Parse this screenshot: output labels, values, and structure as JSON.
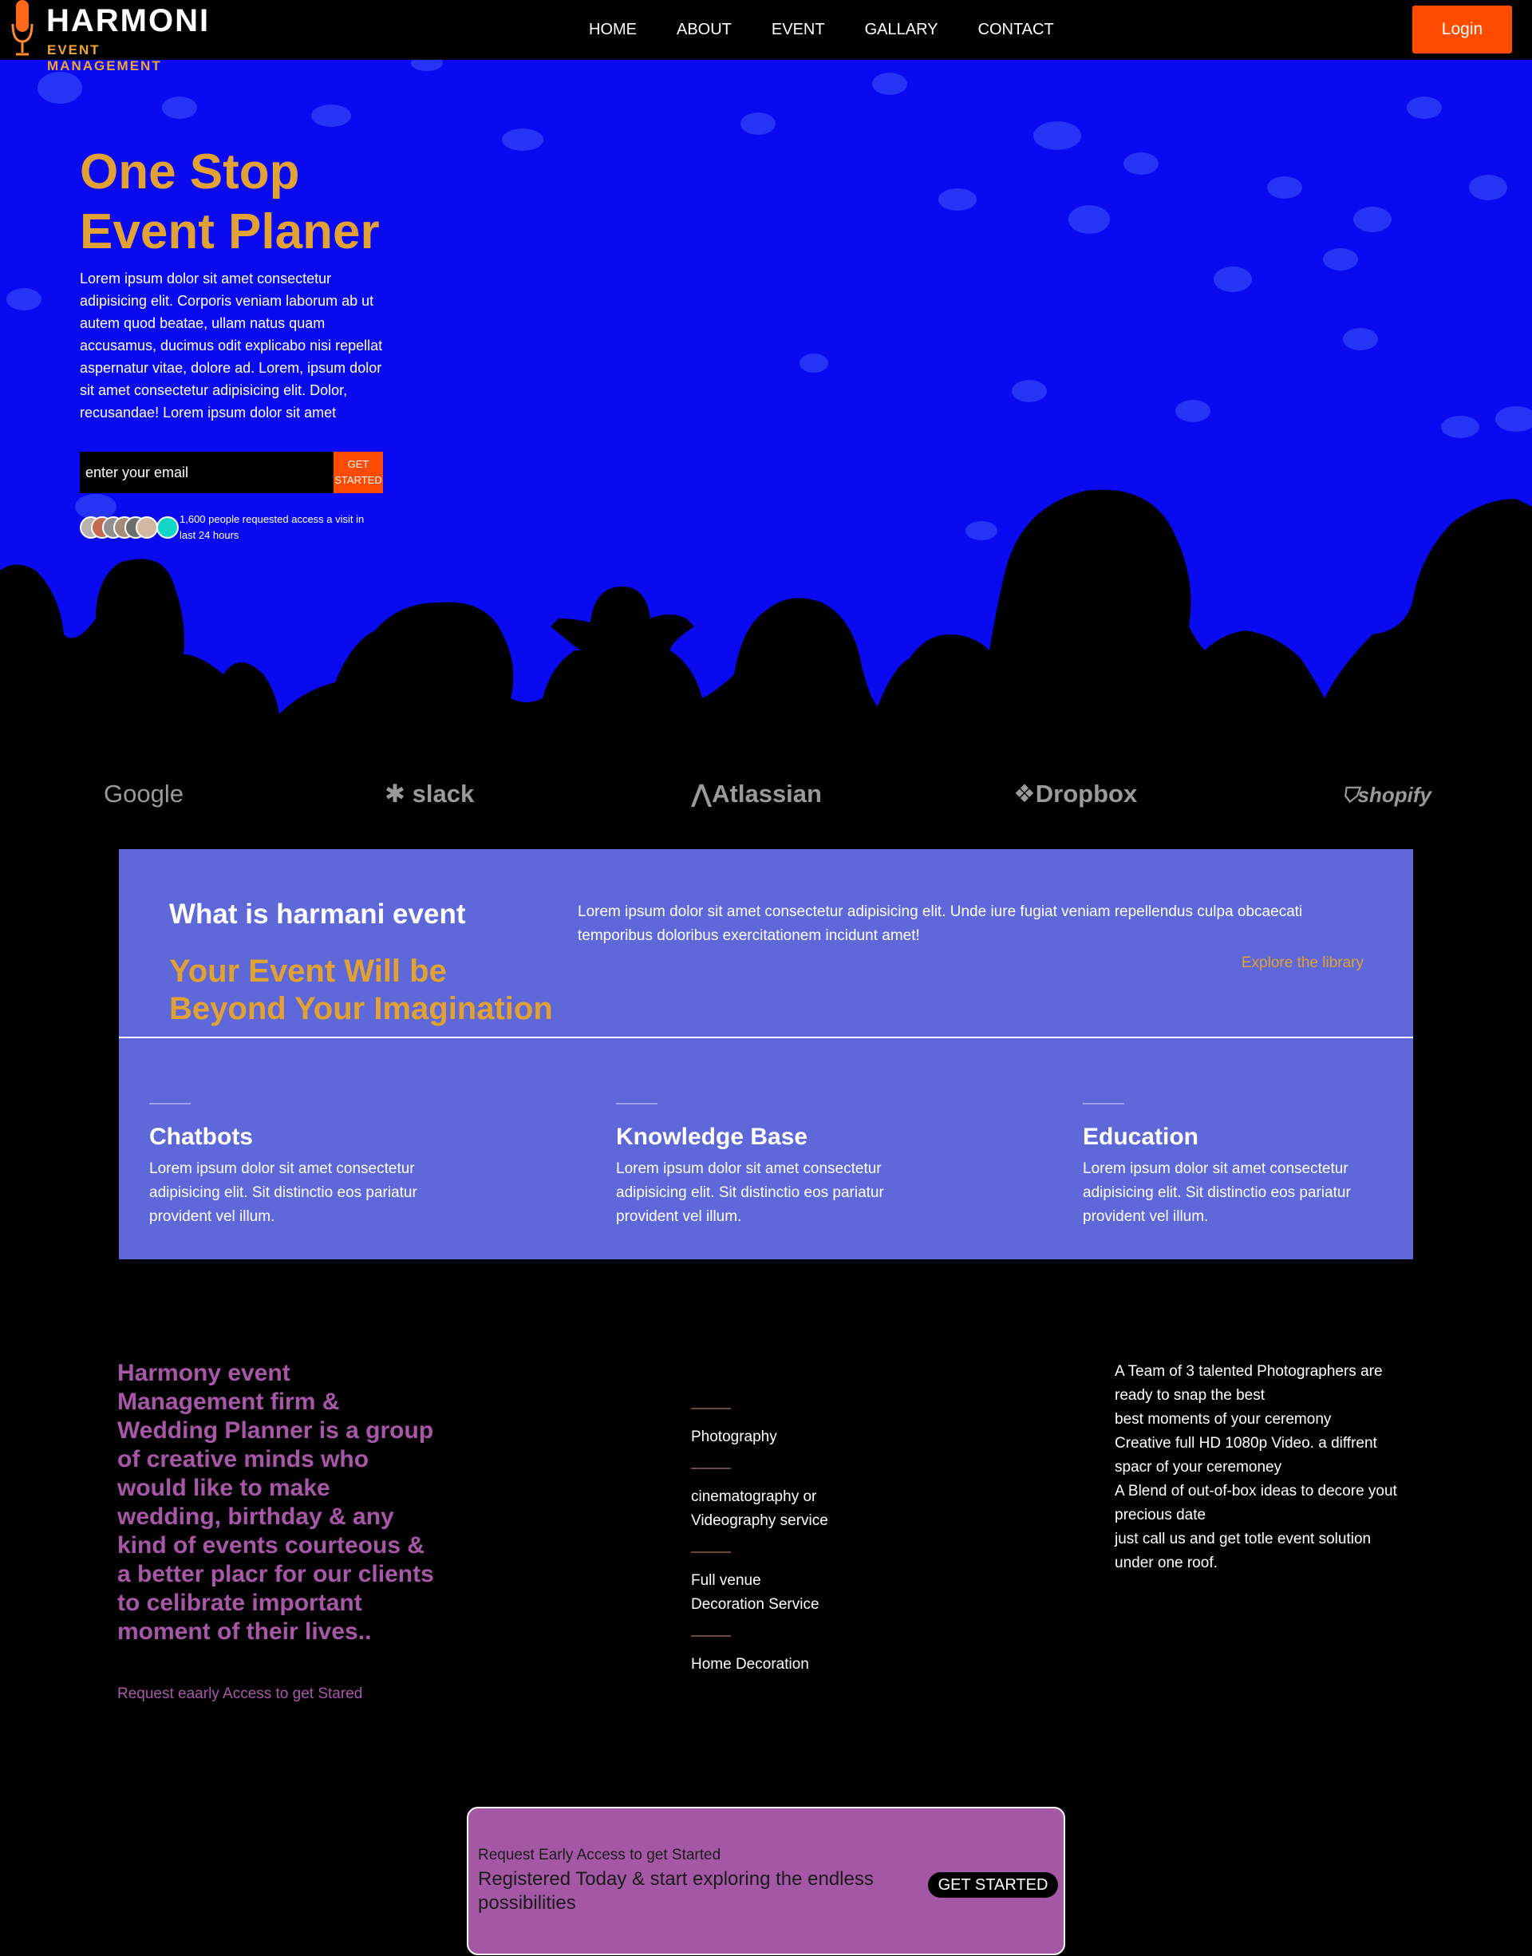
{
  "nav": {
    "logo_title": "HARMONI",
    "logo_subtitle": "EVENT MANAGEMENT",
    "links": [
      "HOME",
      "ABOUT",
      "EVENT",
      "GALLARY",
      "CONTACT"
    ],
    "login_label": "Login"
  },
  "hero": {
    "title": "One Stop Event Planer",
    "description": "Lorem ipsum dolor sit amet consectetur adipisicing elit. Corporis veniam laborum ab ut autem quod beatae, ullam natus quam accusamus, ducimus odit explicabo nisi repellat aspernatur vitae, dolore ad. Lorem, ipsum dolor sit amet consectetur adipisicing elit. Dolor, recusandae! Lorem ipsum dolor sit amet",
    "email_placeholder": "enter your email",
    "get_started_label": "GET STARTED",
    "access_note": "1,600 people requested access a visit in last 24 hours",
    "avatar_colors": [
      "#b8b2ac",
      "#c46b52",
      "#8f8f8f",
      "#a58c78",
      "#6d6d6d",
      "#d2b8a0",
      "#14d6c8"
    ],
    "bg_color": "#0a0af0",
    "accent_color": "#e2a233"
  },
  "brands": [
    "Google",
    "slack",
    "Atlassian",
    "Dropbox",
    "shopify"
  ],
  "what": {
    "title": "What is harmani event",
    "heading": "Your Event Will be Beyond Your Imagination",
    "description": "Lorem ipsum dolor sit amet consectetur adipisicing elit. Unde iure fugiat veniam repellendus culpa obcaecati temporibus doloribus exercitationem incidunt amet!",
    "explore_label": "Explore the library",
    "features": [
      {
        "title": "Chatbots",
        "desc": "Lorem ipsum dolor sit amet consectetur adipisicing elit. Sit distinctio eos pariatur provident vel illum."
      },
      {
        "title": "Knowledge Base",
        "desc": "Lorem ipsum dolor sit amet consectetur adipisicing elit. Sit distinctio eos pariatur provident vel illum."
      },
      {
        "title": "Education",
        "desc": "Lorem ipsum dolor sit amet consectetur adipisicing elit. Sit distinctio eos pariatur provident vel illum."
      }
    ]
  },
  "harmony": {
    "text": "Harmony event Management firm & Wedding Planner is a group of creative minds who would like to make wedding, birthday & any kind of events courteous & a better placr for our clients to celibrate important moment of their lives..",
    "link": "Request eaarly Access to get Stared"
  },
  "services": [
    "Photography",
    "cinematography or Videography service",
    "Full venue Decoration Service",
    "Home Decoration"
  ],
  "team": {
    "lines": [
      "A Team of 3 talented Photographers are ready to snap the best",
      "best moments of your ceremony",
      "Creative full HD 1080p Video. a diffrent spacr of your ceremoney",
      "A Blend of out-of-box ideas to decore yout precious date",
      "just call us and get totle event solution under one roof."
    ]
  },
  "cta": {
    "small": "Request Early Access to get Started",
    "main": "Registered Today & start exploring the endless possibilities",
    "button": "GET STARTED"
  }
}
